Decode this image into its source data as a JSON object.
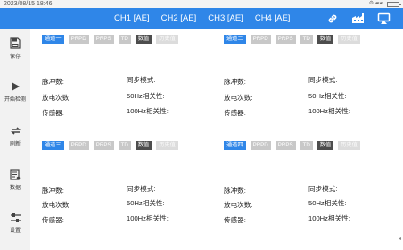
{
  "status_bar": {
    "datetime": "2023/08/15 18:46",
    "system_icons": "⚙ ▰▰"
  },
  "header": {
    "channels": [
      {
        "label": "CH1 [AE]"
      },
      {
        "label": "CH2 [AE]"
      },
      {
        "label": "CH3 [AE]"
      },
      {
        "label": "CH4 [AE]"
      }
    ],
    "icons": [
      "link-icon",
      "factory-icon",
      "cast-icon"
    ]
  },
  "sidebar": {
    "items": [
      {
        "label": "保存",
        "icon": "save-icon"
      },
      {
        "label": "开始检测",
        "icon": "play-icon"
      },
      {
        "label": "刷新",
        "icon": "refresh-icon"
      },
      {
        "label": "数据",
        "icon": "data-icon"
      },
      {
        "label": "设置",
        "icon": "settings-icon"
      }
    ]
  },
  "panels": [
    {
      "tabs": [
        "通道一",
        "PRPD",
        "PRPS",
        "TD",
        "数值",
        "历史值"
      ],
      "fields": {
        "pulse_count": "脉冲数:",
        "discharge_count": "放电次数:",
        "sensor": "传感器:",
        "sync_mode": "同步模式:",
        "corr_50": "50Hz相关性:",
        "corr_100": "100Hz相关性:"
      }
    },
    {
      "tabs": [
        "通道二",
        "PRPD",
        "PRPS",
        "TD",
        "数值",
        "历史值"
      ],
      "fields": {
        "pulse_count": "脉冲数:",
        "discharge_count": "放电次数:",
        "sensor": "传感器:",
        "sync_mode": "同步模式:",
        "corr_50": "50Hz相关性:",
        "corr_100": "100Hz相关性:"
      }
    },
    {
      "tabs": [
        "通道三",
        "PRPD",
        "PRPS",
        "TD",
        "数值",
        "历史值"
      ],
      "fields": {
        "pulse_count": "脉冲数:",
        "discharge_count": "放电次数:",
        "sensor": "传感器:",
        "sync_mode": "同步模式:",
        "corr_50": "50Hz相关性:",
        "corr_100": "100Hz相关性:"
      }
    },
    {
      "tabs": [
        "通道四",
        "PRPD",
        "PRPS",
        "TD",
        "数值",
        "历史值"
      ],
      "fields": {
        "pulse_count": "脉冲数:",
        "discharge_count": "放电次数:",
        "sensor": "传感器:",
        "sync_mode": "同步模式:",
        "corr_50": "50Hz相关性:",
        "corr_100": "100Hz相关性:"
      }
    }
  ],
  "nav_hint": "◂",
  "colors": {
    "accent": "#2f86e8",
    "sidebar_bg": "#f2f2f2",
    "tab_inactive": "#c8c8c8",
    "tab_dark": "#4d4d4d"
  }
}
